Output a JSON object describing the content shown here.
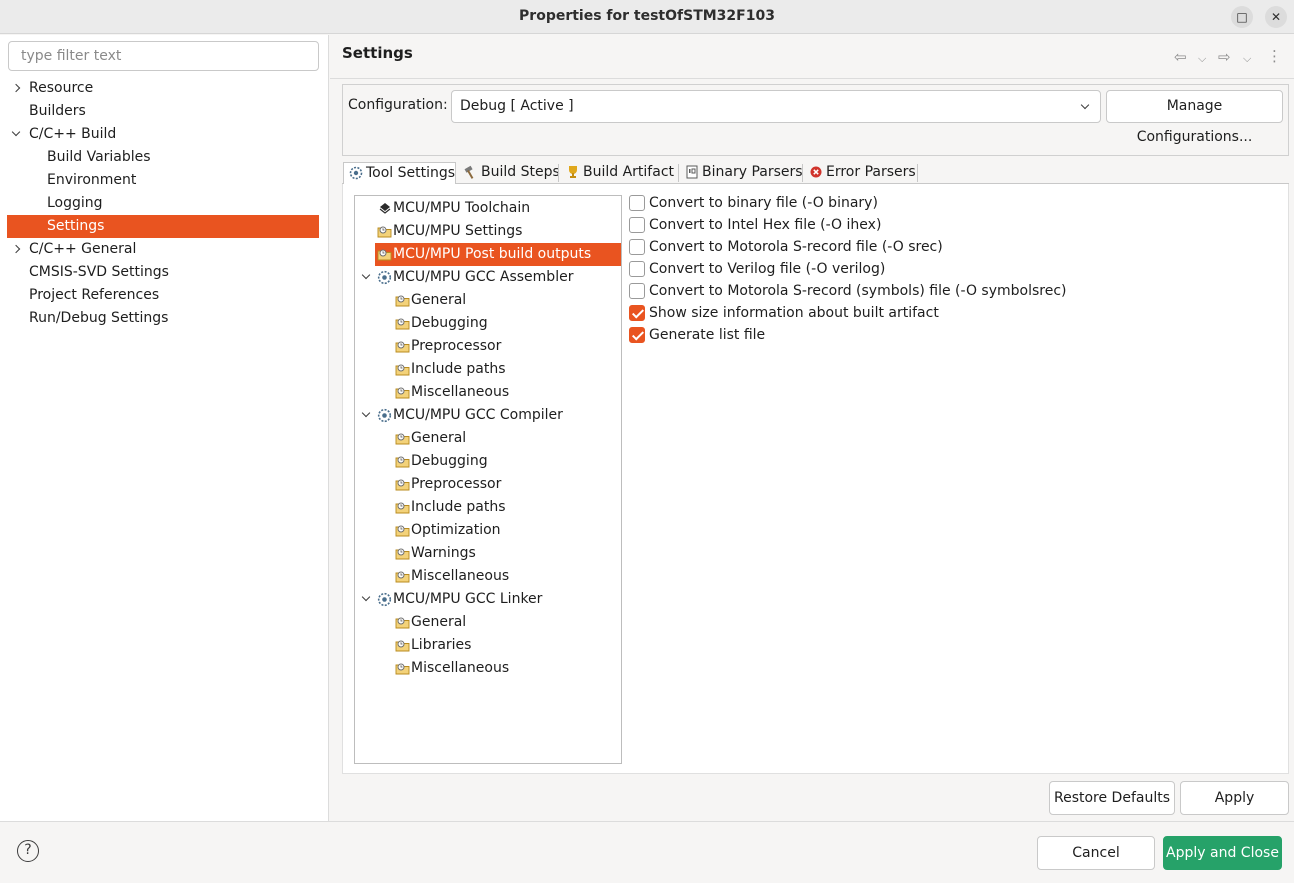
{
  "window": {
    "title": "Properties for testOfSTM32F103",
    "maximize_icon": "□",
    "close_icon": "✕"
  },
  "filter": {
    "placeholder": "type filter text",
    "value": ""
  },
  "nav": {
    "items": [
      {
        "label": "Resource",
        "expander": "collapsed"
      },
      {
        "label": "Builders",
        "expander": "none"
      },
      {
        "label": "C/C++ Build",
        "expander": "expanded"
      },
      {
        "label": "Build Variables",
        "expander": "none"
      },
      {
        "label": "Environment",
        "expander": "none"
      },
      {
        "label": "Logging",
        "expander": "none"
      },
      {
        "label": "Settings",
        "expander": "none",
        "selected": true
      },
      {
        "label": "C/C++ General",
        "expander": "collapsed"
      },
      {
        "label": "CMSIS-SVD Settings",
        "expander": "none"
      },
      {
        "label": "Project References",
        "expander": "none"
      },
      {
        "label": "Run/Debug Settings",
        "expander": "none"
      }
    ]
  },
  "page": {
    "title": "Settings"
  },
  "configuration": {
    "label": "Configuration:",
    "value": "Debug  [ Active ]",
    "manage_label": "Manage Configurations..."
  },
  "tabs": [
    {
      "label": "Tool Settings",
      "icon": "gear-icon",
      "active": true
    },
    {
      "label": "Build Steps",
      "icon": "hammer-icon"
    },
    {
      "label": "Build Artifact",
      "icon": "trophy-icon"
    },
    {
      "label": "Binary Parsers",
      "icon": "binary-file-icon"
    },
    {
      "label": "Error Parsers",
      "icon": "error-icon"
    }
  ],
  "tool_tree": [
    {
      "label": "MCU/MPU Toolchain",
      "icon": "chip-icon"
    },
    {
      "label": "MCU/MPU Settings",
      "icon": "folder-options-icon"
    },
    {
      "label": "MCU/MPU Post build outputs",
      "icon": "folder-options-icon",
      "selected": true
    },
    {
      "label": "MCU/MPU GCC Assembler",
      "icon": "gear-icon",
      "expander": "expanded"
    },
    {
      "label": "General",
      "icon": "folder-options-icon"
    },
    {
      "label": "Debugging",
      "icon": "folder-options-icon"
    },
    {
      "label": "Preprocessor",
      "icon": "folder-options-icon"
    },
    {
      "label": "Include paths",
      "icon": "folder-options-icon"
    },
    {
      "label": "Miscellaneous",
      "icon": "folder-options-icon"
    },
    {
      "label": "MCU/MPU GCC Compiler",
      "icon": "gear-icon",
      "expander": "expanded"
    },
    {
      "label": "General",
      "icon": "folder-options-icon"
    },
    {
      "label": "Debugging",
      "icon": "folder-options-icon"
    },
    {
      "label": "Preprocessor",
      "icon": "folder-options-icon"
    },
    {
      "label": "Include paths",
      "icon": "folder-options-icon"
    },
    {
      "label": "Optimization",
      "icon": "folder-options-icon"
    },
    {
      "label": "Warnings",
      "icon": "folder-options-icon"
    },
    {
      "label": "Miscellaneous",
      "icon": "folder-options-icon"
    },
    {
      "label": "MCU/MPU GCC Linker",
      "icon": "gear-icon",
      "expander": "expanded"
    },
    {
      "label": "General",
      "icon": "folder-options-icon"
    },
    {
      "label": "Libraries",
      "icon": "folder-options-icon"
    },
    {
      "label": "Miscellaneous",
      "icon": "folder-options-icon"
    }
  ],
  "options": [
    {
      "label": "Convert to binary file (-O binary)",
      "checked": false
    },
    {
      "label": "Convert to Intel Hex file (-O ihex)",
      "checked": false
    },
    {
      "label": "Convert to Motorola S-record file (-O srec)",
      "checked": false
    },
    {
      "label": "Convert to Verilog file (-O verilog)",
      "checked": false
    },
    {
      "label": "Convert to Motorola S-record (symbols) file (-O symbolsrec)",
      "checked": false
    },
    {
      "label": "Show size information about built artifact",
      "checked": true
    },
    {
      "label": "Generate list file",
      "checked": true
    }
  ],
  "buttons": {
    "restore_defaults": "Restore Defaults",
    "apply": "Apply",
    "cancel": "Cancel",
    "apply_and_close": "Apply and Close",
    "help": "?"
  },
  "colors": {
    "accent": "#e95420",
    "primary_button": "#26a269"
  }
}
